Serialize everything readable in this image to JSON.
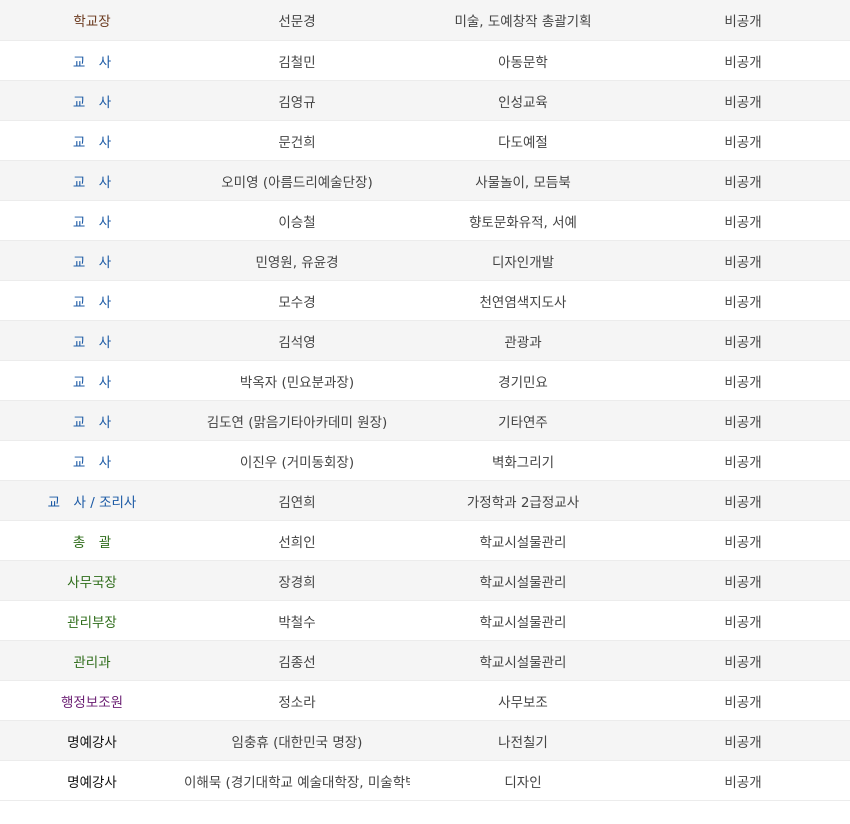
{
  "colors": {
    "brown": "#6b3a1f",
    "blue": "#1c5aa5",
    "green": "#2f6d1b",
    "purple": "#6b1f73",
    "black": "#111111",
    "text": "#444444",
    "stripe": "#f5f5f5"
  },
  "rows": [
    {
      "position": "학교장",
      "name": "선문경",
      "subject": "미술, 도예창작 총괄기획",
      "contact": "비공개"
    },
    {
      "position": "교　사",
      "name": "김철민",
      "subject": "아동문학",
      "contact": "비공개"
    },
    {
      "position": "교　사",
      "name": "김영규",
      "subject": "인성교육",
      "contact": "비공개"
    },
    {
      "position": "교　사",
      "name": "문건희",
      "subject": "다도예절",
      "contact": "비공개"
    },
    {
      "position": "교　사",
      "name": "오미영 (아름드리예술단장)",
      "subject": "사물놀이, 모듬북",
      "contact": "비공개"
    },
    {
      "position": "교　사",
      "name": "이승철",
      "subject": "향토문화유적, 서예",
      "contact": "비공개"
    },
    {
      "position": "교　사",
      "name": "민영원, 유윤경",
      "subject": "디자인개발",
      "contact": "비공개"
    },
    {
      "position": "교　사",
      "name": "모수경",
      "subject": "천연염색지도사",
      "contact": "비공개"
    },
    {
      "position": "교　사",
      "name": "김석영",
      "subject": "관광과",
      "contact": "비공개"
    },
    {
      "position": "교　사",
      "name": "박옥자 (민요분과장)",
      "subject": "경기민요",
      "contact": "비공개"
    },
    {
      "position": "교　사",
      "name": "김도연 (맑음기타아카데미 원장)",
      "subject": "기타연주",
      "contact": "비공개"
    },
    {
      "position": "교　사",
      "name": "이진우 (거미동회장)",
      "subject": "벽화그리기",
      "contact": "비공개"
    },
    {
      "position": "교　사 / 조리사",
      "name": "김연희",
      "subject": "가정학과 2급정교사",
      "contact": "비공개"
    },
    {
      "position": "총　괄",
      "name": "선희인",
      "subject": "학교시설물관리",
      "contact": "비공개"
    },
    {
      "position": "사무국장",
      "name": "장경희",
      "subject": "학교시설물관리",
      "contact": "비공개"
    },
    {
      "position": "관리부장",
      "name": "박철수",
      "subject": "학교시설물관리",
      "contact": "비공개"
    },
    {
      "position": "관리과",
      "name": "김종선",
      "subject": "학교시설물관리",
      "contact": "비공개"
    },
    {
      "position": "행정보조원",
      "name": "정소라",
      "subject": "사무보조",
      "contact": "비공개"
    },
    {
      "position": "명예강사",
      "name": "임충휴 (대한민국 명장)",
      "subject": "나전칠기",
      "contact": "비공개"
    },
    {
      "position": "명예강사",
      "name": "이해묵 (경기대학교 예술대학장, 미술학박사)",
      "subject": "디자인",
      "contact": "비공개"
    }
  ]
}
